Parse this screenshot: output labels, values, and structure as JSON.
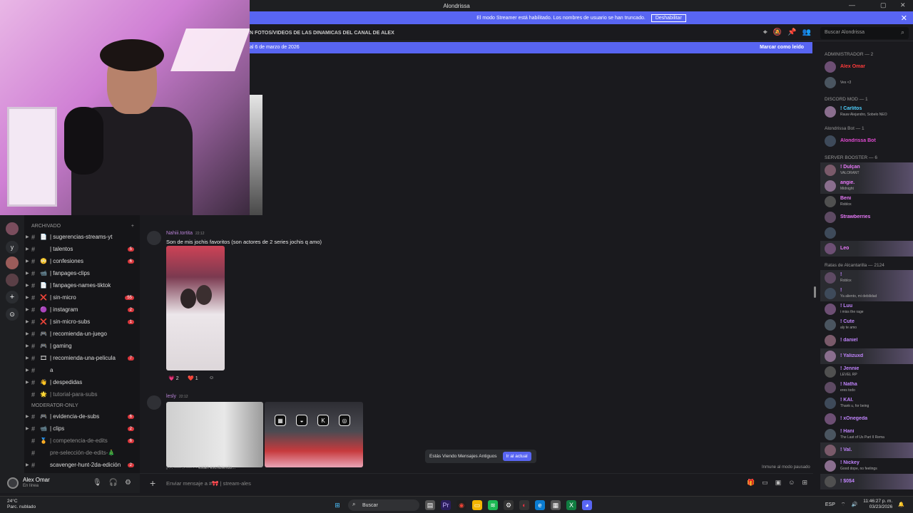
{
  "window": {
    "title": "Alondrissa"
  },
  "banner": {
    "text": "El modo Streamer está habilitado. Los nombres de usuario se han truncado.",
    "button": "Deshabilitar"
  },
  "channel_header": {
    "title": "N FOTOS/VIDEOS DE LAS DINAMICAS DEL CANAL DE ALEX"
  },
  "search": {
    "placeholder": "Buscar Alondrissa"
  },
  "new_messages": {
    "since": "al 6 de marzo de 2026",
    "mark_read": "Marcar como leído"
  },
  "channels": {
    "archive_label": "ARCHIVADO",
    "items": [
      {
        "label": "| sugerencias-streams-yt",
        "emoji": "📄",
        "badge": ""
      },
      {
        "label": "| talentos",
        "emoji": "",
        "badge": "5"
      },
      {
        "label": "| confesiones",
        "emoji": "😳",
        "badge": "6"
      },
      {
        "label": "| fanpages-clips",
        "emoji": "📹",
        "badge": ""
      },
      {
        "label": "| fanpages-names-tiktok",
        "emoji": "📄",
        "badge": ""
      },
      {
        "label": "| sin-micro",
        "emoji": "❌",
        "badge": "55"
      },
      {
        "label": "| instagram",
        "emoji": "🟣",
        "badge": "2"
      },
      {
        "label": "| sin-micro-subs",
        "emoji": "❌",
        "badge": "1"
      },
      {
        "label": "| recomienda-un-juego",
        "emoji": "🎮",
        "badge": ""
      },
      {
        "label": "| gaming",
        "emoji": "🎮",
        "badge": ""
      },
      {
        "label": "| recomienda-una-pelicula",
        "emoji": "🎞",
        "badge": "7"
      },
      {
        "label": "a",
        "emoji": "",
        "badge": ""
      },
      {
        "label": "| despedidas",
        "emoji": "👋",
        "badge": ""
      },
      {
        "label": "| tutorial-para-subs",
        "emoji": "🌟",
        "badge": "",
        "muted": true
      }
    ],
    "section": "MODERATOR-ONLY",
    "items2": [
      {
        "label": "| evidencia-de-subs",
        "emoji": "🎮",
        "badge": "6"
      },
      {
        "label": "| clips",
        "emoji": "📹",
        "badge": "2"
      },
      {
        "label": "| competencia-de-edits",
        "emoji": "🏅",
        "badge": "6",
        "muted": true
      },
      {
        "label": "pre-selección-de-edits-🎄",
        "emoji": "",
        "badge": "",
        "muted": true
      },
      {
        "label": "scavenger-hunt-2da-edición",
        "emoji": "",
        "badge": "2"
      }
    ]
  },
  "user": {
    "name": "Alex Omar",
    "status": "En línea"
  },
  "messages": [
    {
      "author": "Nahiii.tortita",
      "time": "22:12",
      "text": "Son de mis jochis favoritos (son actores de 2 series jochis q amo)"
    },
    {
      "author": "lesly",
      "time": "22:12"
    }
  ],
  "reactions": [
    {
      "emoji": "💗",
      "count": "2"
    },
    {
      "emoji": "❤️",
      "count": "1"
    }
  ],
  "typing": "¡·:·: ·····  :· ···· · · están escribiendo...",
  "jump": {
    "text": "Estás Viendo Mensajes Antiguos",
    "button": "Ir al actual"
  },
  "immune": "Inmune al modo pausado",
  "composer": {
    "placeholder": "Enviar mensaje a #🎀 | stream-ales"
  },
  "members": {
    "groups": [
      {
        "title": "ADMINISTRADOR — 2",
        "list": [
          {
            "name": "Alex Omar",
            "color": "#ff3b3b",
            "status": ""
          },
          {
            "name": "",
            "color": "#ff3b3b",
            "status": "Ves <3"
          }
        ]
      },
      {
        "title": "DISCORD MOD — 1",
        "list": [
          {
            "name": "! Carlitos",
            "color": "#4fd1ff",
            "status": "Rauw Alejandro, Sobelo NEO"
          }
        ]
      },
      {
        "title": "Alondrissa Bot — 1",
        "list": [
          {
            "name": "Alondrissa Bot",
            "color": "#e34bd3",
            "status": ""
          }
        ]
      },
      {
        "title": "SERVER BOOSTER — 6",
        "list": [
          {
            "name": "! Dulçan",
            "color": "#e879f9",
            "status": "VALORANT",
            "hl": true
          },
          {
            "name": "angie.",
            "color": "#e879f9",
            "status": "Midnight",
            "hl": true
          },
          {
            "name": "Beni",
            "color": "#e879f9",
            "status": "Roblox"
          },
          {
            "name": "Strawberries",
            "color": "#e879f9",
            "status": ""
          },
          {
            "name": "",
            "color": "#e879f9",
            "status": ""
          },
          {
            "name": "Leo",
            "color": "#e879f9",
            "status": "",
            "hl": true
          }
        ]
      },
      {
        "title": "Ratas de Alcantarilla — 2124",
        "list": [
          {
            "name": "!",
            "color": "#c084fc",
            "status": "Roblox",
            "hl": true
          },
          {
            "name": "!",
            "color": "#c084fc",
            "status": "Ya aliento, mi debilidad",
            "hl": true
          },
          {
            "name": "! Luu",
            "color": "#c084fc",
            "status": "i miss the rage"
          },
          {
            "name": "! Cute",
            "color": "#c084fc",
            "status": "aly te amo"
          },
          {
            "name": "! daniel",
            "color": "#c084fc",
            "status": ""
          },
          {
            "name": "! Yalizuxd",
            "color": "#c084fc",
            "status": "",
            "hl": true
          },
          {
            "name": "! Jennie",
            "color": "#c084fc",
            "status": "LEVEL RP"
          },
          {
            "name": "! Natha",
            "color": "#c084fc",
            "status": "eres todo"
          },
          {
            "name": "! KAI.",
            "color": "#c084fc",
            "status": "Thank u, for being"
          },
          {
            "name": "! xOnegeda",
            "color": "#c084fc",
            "status": ""
          },
          {
            "name": "! Hani",
            "color": "#c084fc",
            "status": "The Last of Us Part II Rema"
          },
          {
            "name": "! Val.",
            "color": "#c084fc",
            "status": "",
            "hl": true
          },
          {
            "name": "! Nickey",
            "color": "#c084fc",
            "status": "Good dope, no feelings"
          },
          {
            "name": "! $0$4",
            "color": "#c084fc",
            "status": "",
            "hl": true
          }
        ]
      }
    ]
  },
  "taskbar": {
    "weather_temp": "24°C",
    "weather_desc": "Parc. nublado",
    "search": "Buscar",
    "lang": "ESP",
    "time": "11:46:27 p. m.",
    "date": "03/23/2026"
  }
}
